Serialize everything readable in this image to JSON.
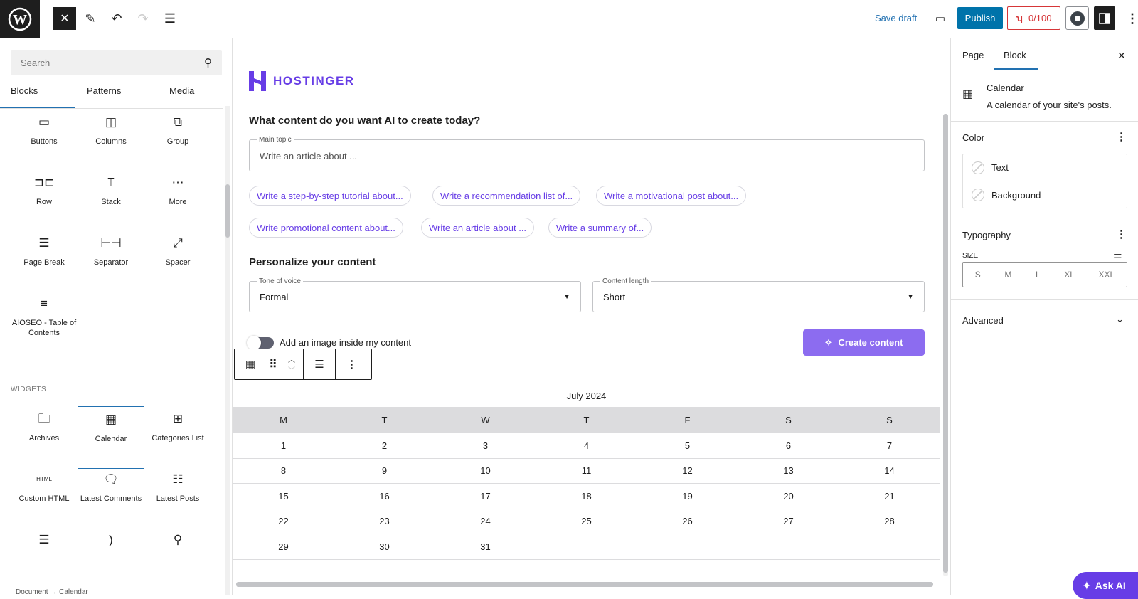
{
  "topbar": {
    "save_draft": "Save draft",
    "publish": "Publish",
    "seo_score": "0/100"
  },
  "left": {
    "search_placeholder": "Search",
    "tabs": [
      "Blocks",
      "Patterns",
      "Media"
    ],
    "blocks": [
      {
        "label": "Buttons",
        "icon": "▭"
      },
      {
        "label": "Columns",
        "icon": "◫"
      },
      {
        "label": "Group",
        "icon": "⧉"
      },
      {
        "label": "Row",
        "icon": "⊐⊏"
      },
      {
        "label": "Stack",
        "icon": "⌶"
      },
      {
        "label": "More",
        "icon": "⋯"
      },
      {
        "label": "Page Break",
        "icon": "☰"
      },
      {
        "label": "Separator",
        "icon": "⊢⊣"
      },
      {
        "label": "Spacer",
        "icon": "⤢"
      },
      {
        "label": "AIOSEO - Table of Contents",
        "icon": "≡"
      }
    ],
    "widgets_heading": "WIDGETS",
    "widgets": [
      {
        "label": "Archives",
        "icon": "🗀"
      },
      {
        "label": "Calendar",
        "icon": "▦"
      },
      {
        "label": "Categories List",
        "icon": "⊞"
      },
      {
        "label": "Custom HTML",
        "icon": "HTML"
      },
      {
        "label": "Latest Comments",
        "icon": "🗨"
      },
      {
        "label": "Latest Posts",
        "icon": "☷"
      },
      {
        "label": "",
        "icon": "☰"
      },
      {
        "label": "",
        "icon": ")"
      },
      {
        "label": "",
        "icon": "⚲"
      }
    ],
    "breadcrumb": [
      "Document",
      "Calendar"
    ]
  },
  "canvas": {
    "logo": "HOSTINGER",
    "question": "What content do you want AI to create today?",
    "main_topic_label": "Main topic",
    "main_topic_placeholder": "Write an article about ...",
    "chips": [
      "Write a step-by-step tutorial about...",
      "Write a recommendation list of...",
      "Write a motivational post about...",
      "Write promotional content about...",
      "Write an article about ...",
      "Write a summary of..."
    ],
    "personalize": "Personalize your content",
    "tone_label": "Tone of voice",
    "tone_value": "Formal",
    "length_label": "Content length",
    "length_value": "Short",
    "image_toggle": "Add an image inside my content",
    "image_toggle_on": false,
    "create": "Create content",
    "calendar": {
      "caption": "July 2024",
      "days": [
        "M",
        "T",
        "W",
        "T",
        "F",
        "S",
        "S"
      ],
      "weeks": [
        [
          "1",
          "2",
          "3",
          "4",
          "5",
          "6",
          "7"
        ],
        [
          "8",
          "9",
          "10",
          "11",
          "12",
          "13",
          "14"
        ],
        [
          "15",
          "16",
          "17",
          "18",
          "19",
          "20",
          "21"
        ],
        [
          "22",
          "23",
          "24",
          "25",
          "26",
          "27",
          "28"
        ],
        [
          "29",
          "30",
          "31",
          "",
          "",
          "",
          ""
        ]
      ],
      "linked_day": "8"
    }
  },
  "right": {
    "tabs": [
      "Page",
      "Block"
    ],
    "block_name": "Calendar",
    "block_desc": "A calendar of your site's posts.",
    "color": "Color",
    "color_items": [
      "Text",
      "Background"
    ],
    "typography": "Typography",
    "size_label": "SIZE",
    "sizes": [
      "S",
      "M",
      "L",
      "XL",
      "XXL"
    ],
    "advanced": "Advanced"
  },
  "ask_ai": "Ask AI",
  "colors": {
    "accent": "#2271b1",
    "publish": "#0073aa",
    "brand": "#673de6",
    "create_button": "#8c6cf0",
    "score": "#d63638"
  }
}
